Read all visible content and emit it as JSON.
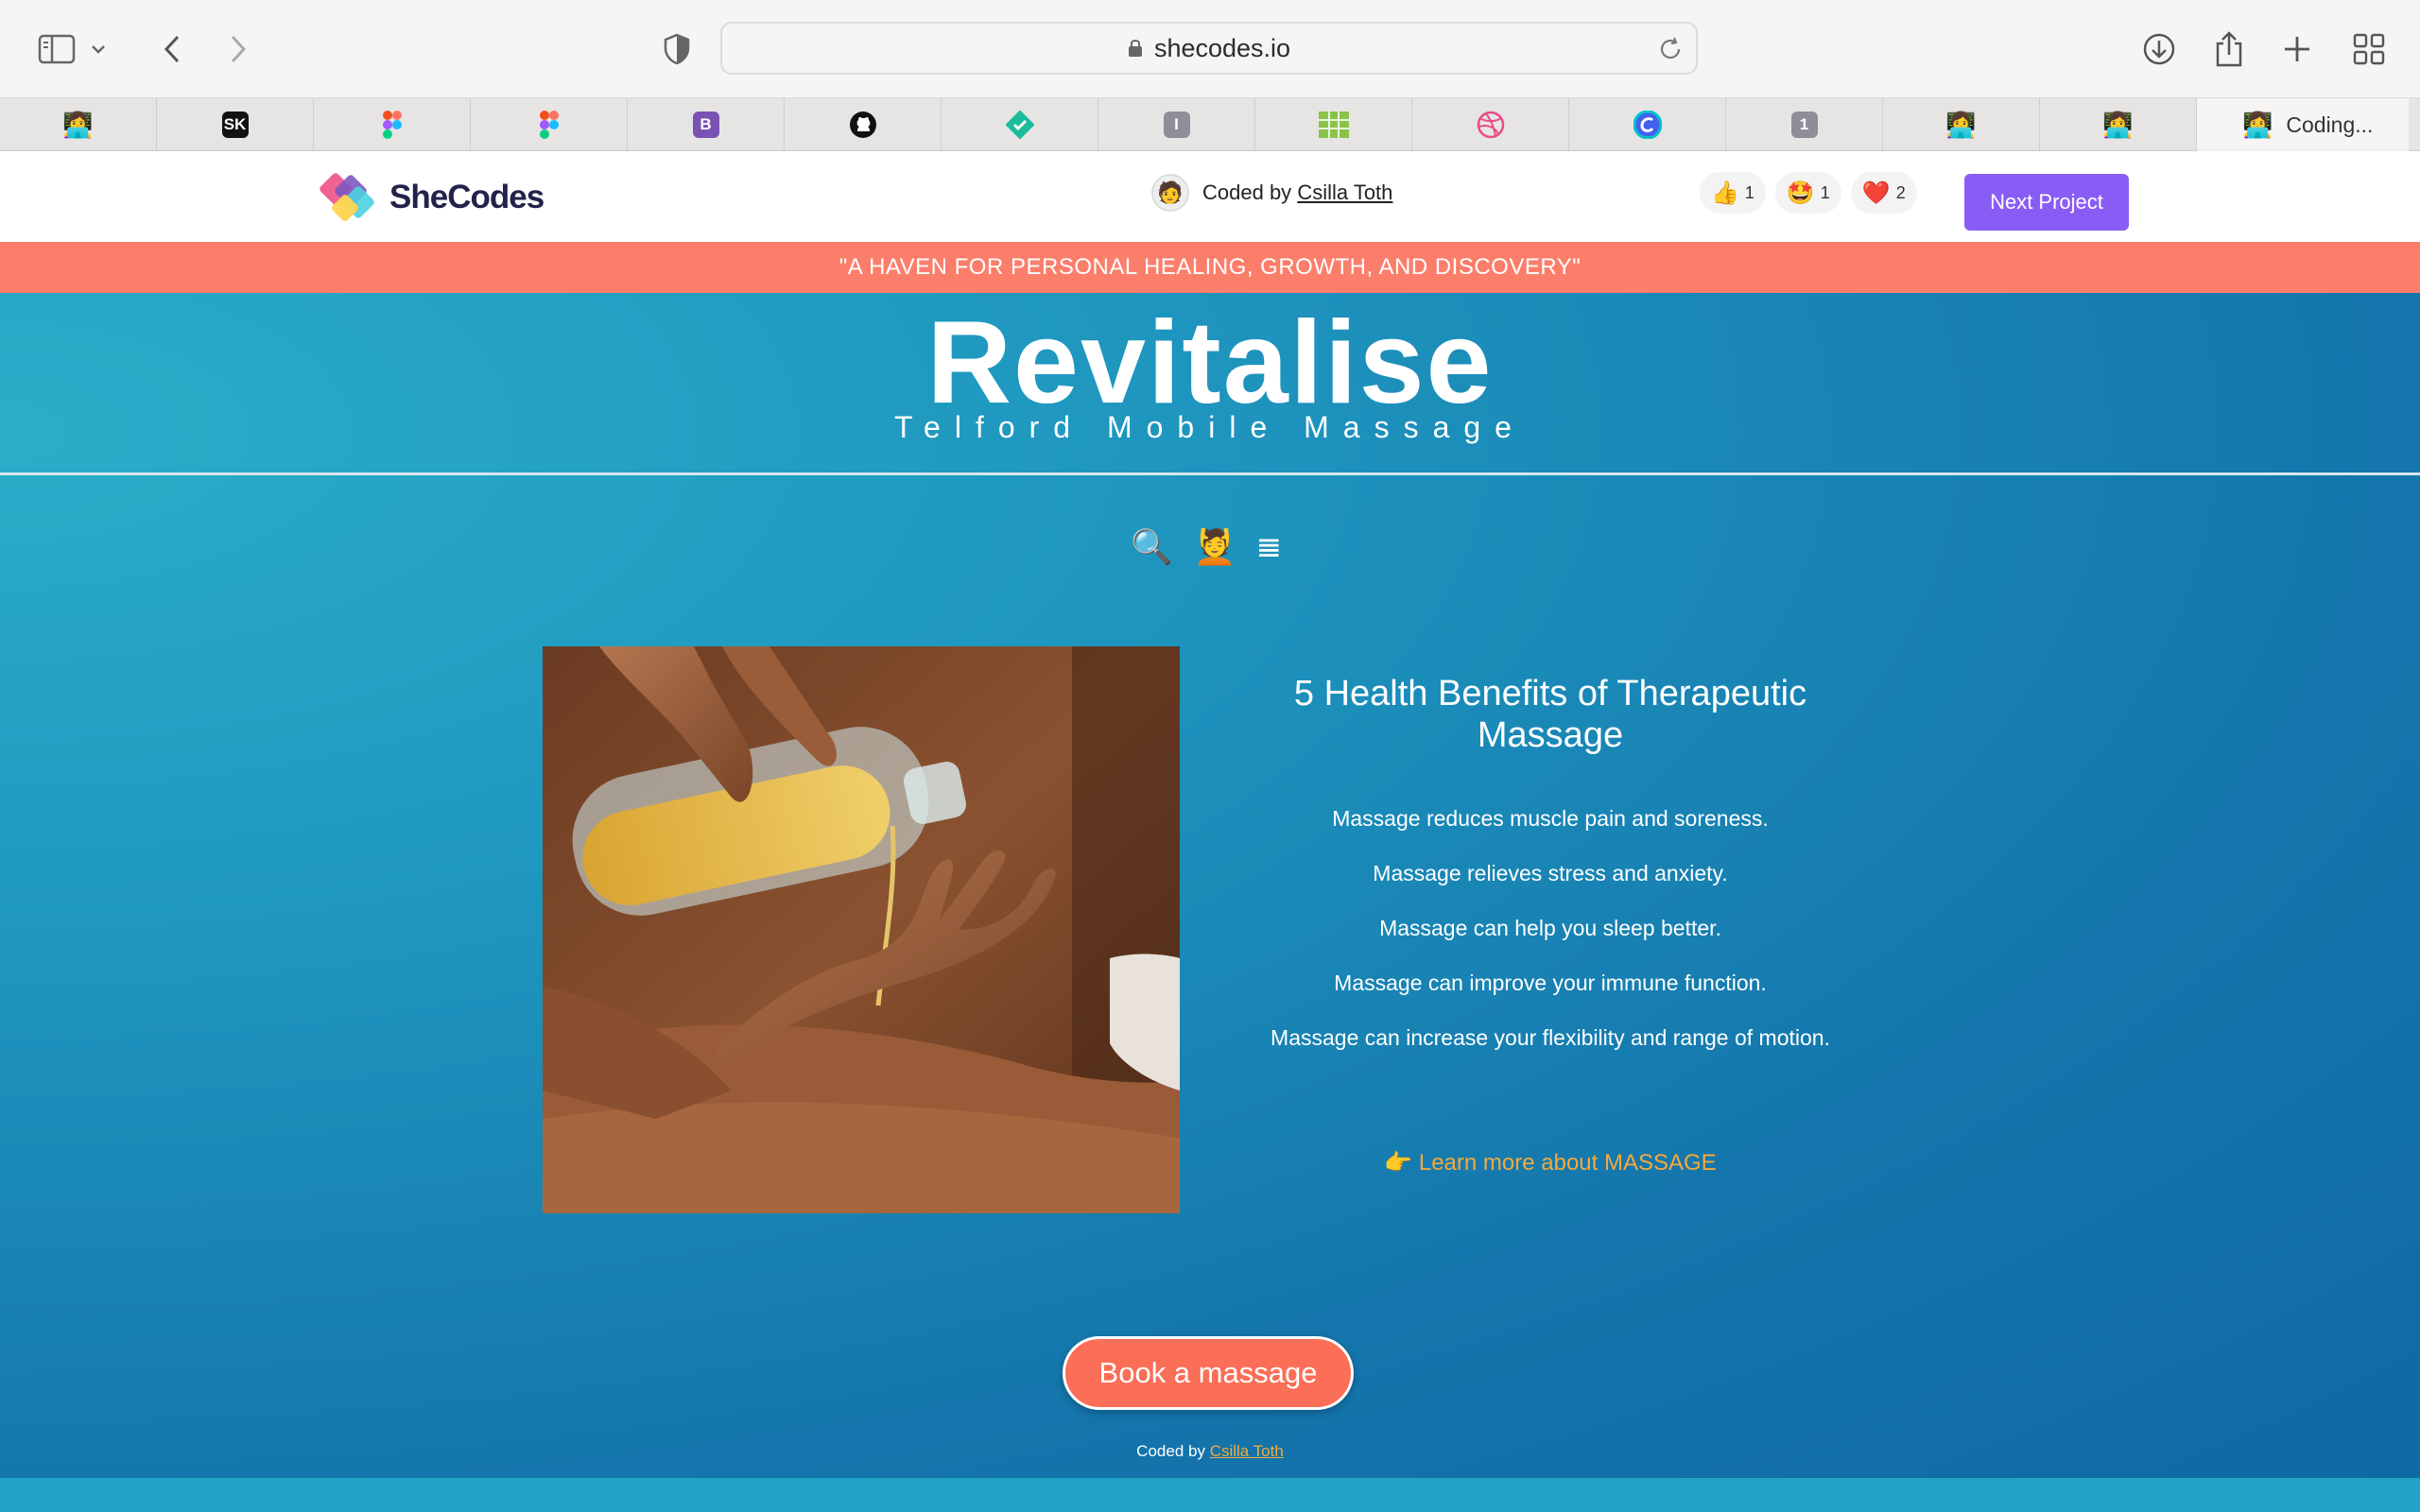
{
  "browser": {
    "url": "shecodes.io",
    "active_tab_title": "Coding...",
    "tab_favicons": [
      "coder-emoji",
      "sk",
      "figma",
      "figma",
      "bootstrap",
      "github",
      "check",
      "i-icon",
      "grid",
      "dribbble",
      "canva",
      "one",
      "coder-emoji",
      "coder-emoji"
    ],
    "tab_labels": [
      "SK",
      "B",
      "I",
      "1"
    ]
  },
  "shecodes_bar": {
    "logo_text": "SheCodes",
    "coded_by_prefix": "Coded by",
    "author": "Csilla Toth",
    "reactions": [
      {
        "icon": "thumbs-up-emoji",
        "glyph": "👍",
        "count": "1"
      },
      {
        "icon": "star-struck-emoji",
        "glyph": "🤩",
        "count": "1"
      },
      {
        "icon": "heart-emoji",
        "glyph": "❤️",
        "count": "2"
      }
    ],
    "next_project_label": "Next Project"
  },
  "page": {
    "banner": "\"A HAVEN FOR PERSONAL HEALING, GROWTH, AND DISCOVERY\"",
    "brand": "Revitalise",
    "tagline": "Telford Mobile Massage",
    "nav_icons": [
      "🔍",
      "💆",
      "𝌆"
    ],
    "article_title": "5 Health Benefits of Therapeutic Massage",
    "benefits": [
      "Massage reduces muscle pain and soreness.",
      "Massage relieves stress and anxiety.",
      "Massage can help you sleep better.",
      "Massage can improve your immune function.",
      "Massage can increase your flexibility and range of motion."
    ],
    "learn_more": "👉 Learn more about MASSAGE",
    "book_button": "Book a massage",
    "footer_prefix": "Coded by",
    "footer_author": "Csilla Toth"
  },
  "colors": {
    "banner": "#fb7e6b",
    "page_bg": "#1e95be",
    "button": "#fb6e57",
    "link": "#f5a93c",
    "next_button": "#8a5cf6"
  }
}
